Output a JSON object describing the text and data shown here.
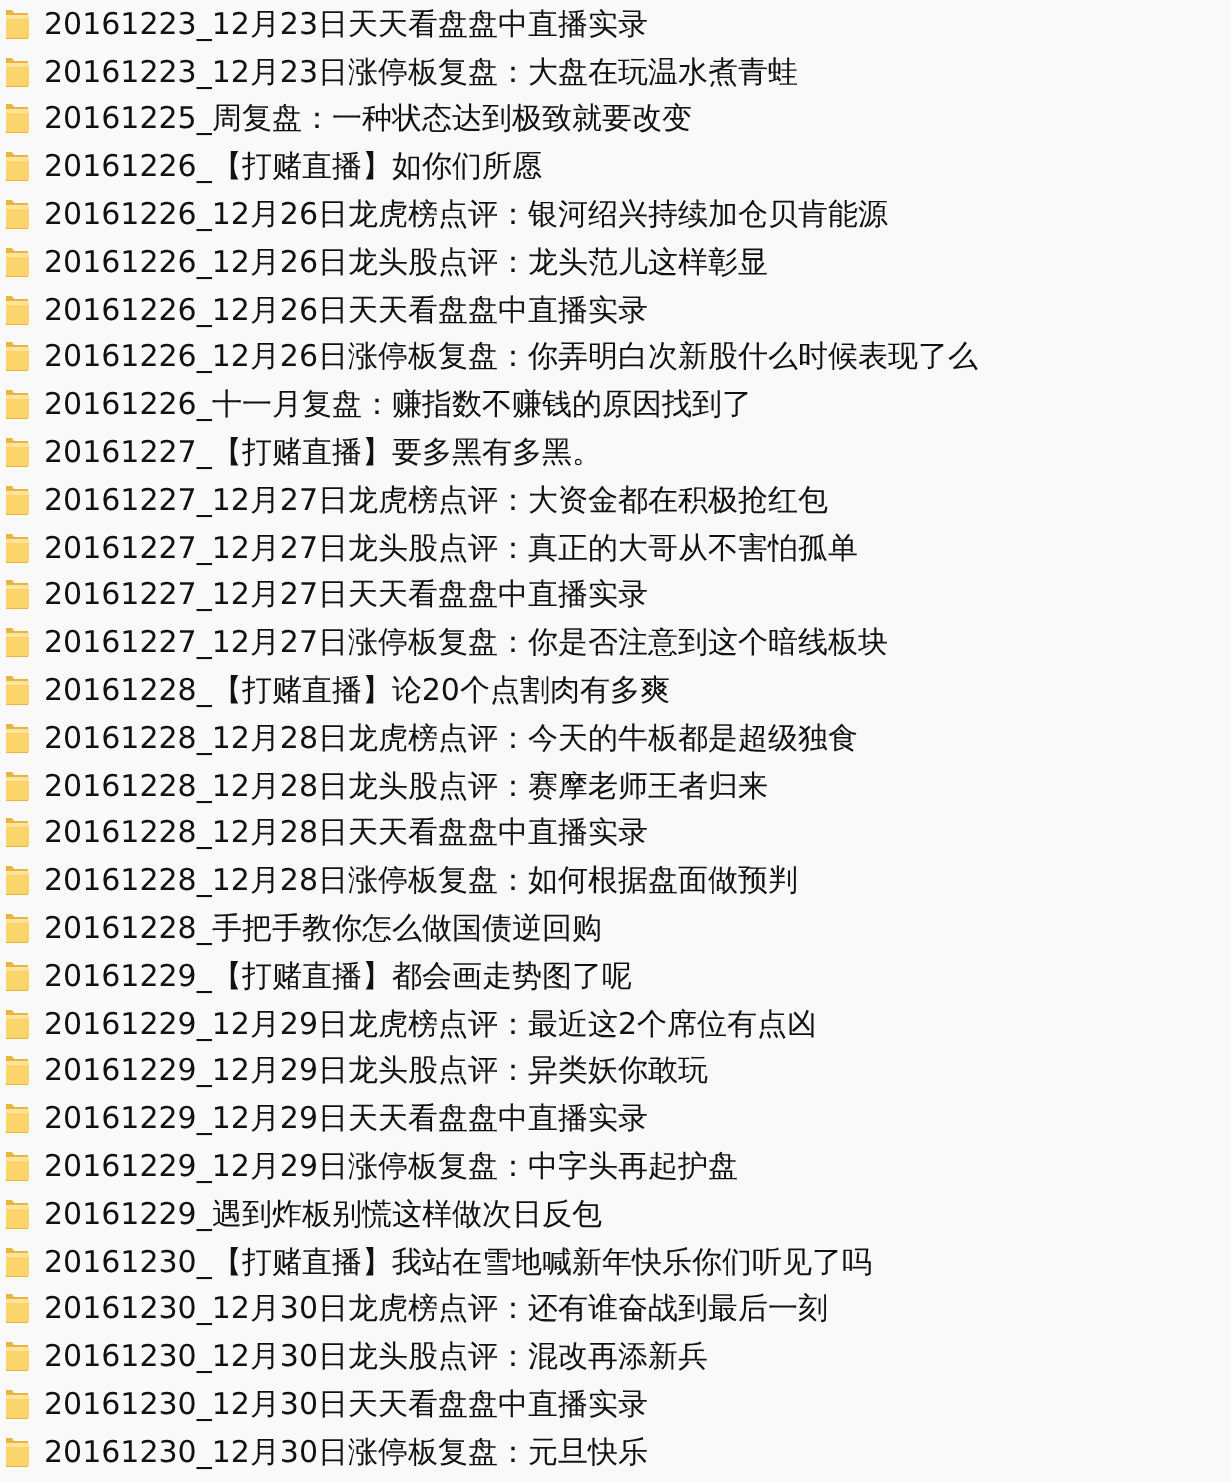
{
  "folders": [
    {
      "name": "20161223_12月23日天天看盘盘中直播实录"
    },
    {
      "name": "20161223_12月23日涨停板复盘：大盘在玩温水煮青蛙"
    },
    {
      "name": "20161225_周复盘：一种状态达到极致就要改变"
    },
    {
      "name": "20161226_【打赌直播】如你们所愿"
    },
    {
      "name": "20161226_12月26日龙虎榜点评：银河绍兴持续加仓贝肯能源"
    },
    {
      "name": "20161226_12月26日龙头股点评：龙头范儿这样彰显"
    },
    {
      "name": "20161226_12月26日天天看盘盘中直播实录"
    },
    {
      "name": "20161226_12月26日涨停板复盘：你弄明白次新股什么时候表现了么"
    },
    {
      "name": "20161226_十一月复盘：赚指数不赚钱的原因找到了"
    },
    {
      "name": "20161227_【打赌直播】要多黑有多黑。"
    },
    {
      "name": "20161227_12月27日龙虎榜点评：大资金都在积极抢红包"
    },
    {
      "name": "20161227_12月27日龙头股点评：真正的大哥从不害怕孤单"
    },
    {
      "name": "20161227_12月27日天天看盘盘中直播实录"
    },
    {
      "name": "20161227_12月27日涨停板复盘：你是否注意到这个暗线板块"
    },
    {
      "name": "20161228_【打赌直播】论20个点割肉有多爽"
    },
    {
      "name": "20161228_12月28日龙虎榜点评：今天的牛板都是超级独食"
    },
    {
      "name": "20161228_12月28日龙头股点评：赛摩老师王者归来"
    },
    {
      "name": "20161228_12月28日天天看盘盘中直播实录"
    },
    {
      "name": "20161228_12月28日涨停板复盘：如何根据盘面做预判"
    },
    {
      "name": "20161228_手把手教你怎么做国债逆回购"
    },
    {
      "name": "20161229_【打赌直播】都会画走势图了呢"
    },
    {
      "name": "20161229_12月29日龙虎榜点评：最近这2个席位有点凶"
    },
    {
      "name": "20161229_12月29日龙头股点评：异类妖你敢玩"
    },
    {
      "name": "20161229_12月29日天天看盘盘中直播实录"
    },
    {
      "name": "20161229_12月29日涨停板复盘：中字头再起护盘"
    },
    {
      "name": "20161229_遇到炸板别慌这样做次日反包"
    },
    {
      "name": "20161230_【打赌直播】我站在雪地喊新年快乐你们听见了吗"
    },
    {
      "name": "20161230_12月30日龙虎榜点评：还有谁奋战到最后一刻"
    },
    {
      "name": "20161230_12月30日龙头股点评：混改再添新兵"
    },
    {
      "name": "20161230_12月30日天天看盘盘中直播实录"
    },
    {
      "name": "20161230_12月30日涨停板复盘：元旦快乐"
    }
  ]
}
